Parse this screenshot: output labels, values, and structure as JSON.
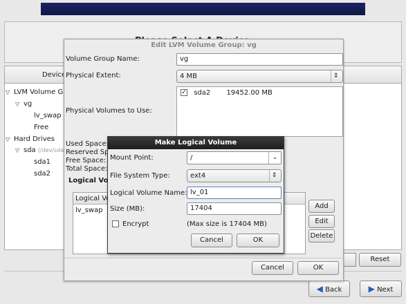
{
  "background": {
    "page_title": "Please Select A Device",
    "tree_header": "Device",
    "tree": [
      {
        "label": "LVM Volume G",
        "indent": 0,
        "expander": "▽"
      },
      {
        "label": "vg",
        "indent": 1,
        "expander": "▽"
      },
      {
        "label": "lv_swap",
        "indent": 2,
        "expander": ""
      },
      {
        "label": "Free",
        "indent": 2,
        "expander": ""
      },
      {
        "label": "Hard Drives",
        "indent": 0,
        "expander": "▽"
      },
      {
        "label": "sda",
        "sub": "(/dev/sda)",
        "indent": 1,
        "expander": "▽"
      },
      {
        "label": "sda1",
        "indent": 2,
        "expander": ""
      },
      {
        "label": "sda2",
        "indent": 2,
        "expander": ""
      }
    ],
    "reset_label": "Reset",
    "back_label": "Back",
    "next_label": "Next"
  },
  "lvm_dialog": {
    "title": "Edit LVM Volume Group: vg",
    "vg_name_label": "Volume Group Name:",
    "vg_name_value": "vg",
    "pe_label": "Physical Extent:",
    "pe_value": "4 MB",
    "pv_label": "Physical Volumes to Use:",
    "pv_items": [
      {
        "name": "sda2",
        "size": "19452.00 MB",
        "checked": true
      }
    ],
    "used_space_label": "Used Space:",
    "reserved_space_label": "Reserved Spa",
    "free_space_label": "Free Space:",
    "total_space_label": "Total Space:",
    "lv_section_label": "Logical Vo",
    "lv_table_header": "Logical Vo",
    "lv_rows": [
      "lv_swap"
    ],
    "add_label": "Add",
    "edit_label": "Edit",
    "delete_label": "Delete",
    "cancel_label": "Cancel",
    "ok_label": "OK"
  },
  "make_lv_dialog": {
    "title": "Make Logical Volume",
    "mount_label": "Mount Point:",
    "mount_value": "/",
    "fs_label": "File System Type:",
    "fs_value": "ext4",
    "lv_name_label": "Logical Volume Name:",
    "lv_name_value": "lv_01",
    "size_label": "Size (MB):",
    "size_value": "17404",
    "encrypt_label": "Encrypt",
    "encrypt_checked": false,
    "max_size_text": "(Max size is 17404 MB)",
    "cancel_label": "Cancel",
    "ok_label": "OK"
  }
}
